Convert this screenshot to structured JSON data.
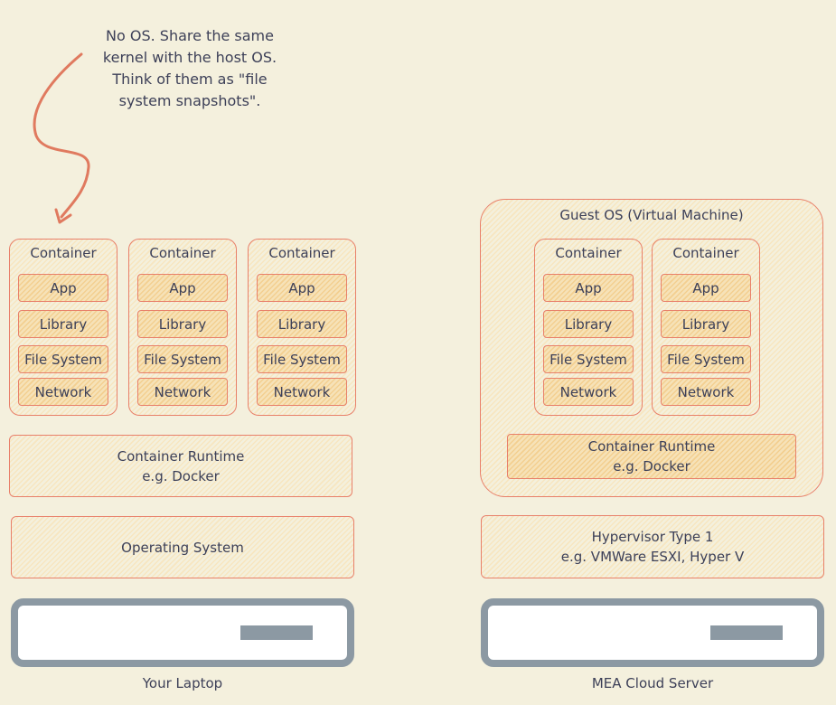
{
  "annotation": [
    "No OS. Share the same",
    "kernel with the host OS.",
    "Think of them as \"file",
    "system snapshots\"."
  ],
  "container": {
    "title": "Container",
    "layers": [
      "App",
      "Library",
      "File System",
      "Network"
    ]
  },
  "laptop": {
    "runtime": [
      "Container Runtime",
      "e.g. Docker"
    ],
    "os": "Operating System",
    "label": "Your Laptop"
  },
  "server": {
    "guest_os": "Guest OS (Virtual Machine)",
    "runtime": [
      "Container Runtime",
      "e.g. Docker"
    ],
    "hypervisor": [
      "Hypervisor Type 1",
      "e.g. VMWare ESXI, Hyper V"
    ],
    "label": "MEA Cloud Server"
  },
  "colors": {
    "background": "#f4f0dd",
    "stroke": "#e8806a",
    "device": "#8c99a3"
  }
}
